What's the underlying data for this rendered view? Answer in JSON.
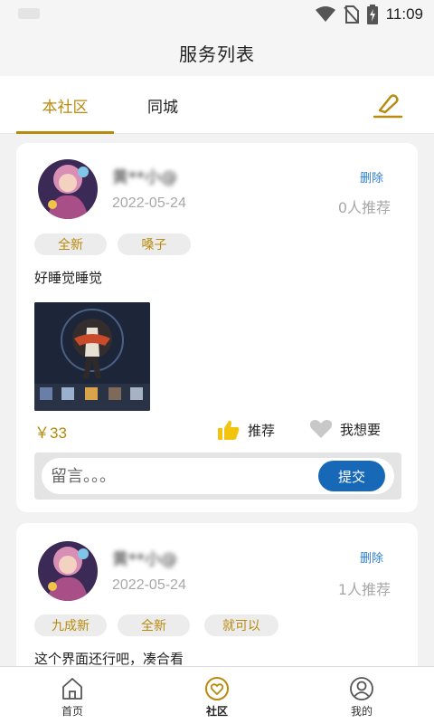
{
  "status_bar": {
    "time": "11:09",
    "icons": [
      "wifi-icon",
      "no-sim-icon",
      "battery-charging-icon"
    ]
  },
  "header": {
    "title": "服务列表"
  },
  "tabs": [
    {
      "label": "本社区",
      "active": true
    },
    {
      "label": "同城",
      "active": false
    }
  ],
  "edit_icon": "edit-icon",
  "posts": [
    {
      "user_name": "黄**小@",
      "date": "2022-05-24",
      "delete_label": "删除",
      "recommend_count": "0人推荐",
      "tags": [
        "全新",
        "嗓子"
      ],
      "content": "好睡觉睡觉",
      "price": "￥33",
      "recommend_label": "推荐",
      "want_label": "我想要",
      "comment_placeholder": "留言。。。",
      "submit_label": "提交"
    },
    {
      "user_name": "黄**小@",
      "date": "2022-05-24",
      "delete_label": "删除",
      "recommend_count": "1人推荐",
      "tags": [
        "九成新",
        "全新",
        "就可以"
      ],
      "content": "这个界面还行吧，凑合看"
    }
  ],
  "bottom_nav": [
    {
      "label": "首页",
      "icon": "home-icon",
      "active": false
    },
    {
      "label": "社区",
      "icon": "community-heart-icon",
      "active": true
    },
    {
      "label": "我的",
      "icon": "profile-icon",
      "active": false
    }
  ],
  "colors": {
    "accent": "#b88a0d",
    "link": "#2c7fd6",
    "submit": "#1769b8",
    "thumb": "#f2c40f"
  }
}
